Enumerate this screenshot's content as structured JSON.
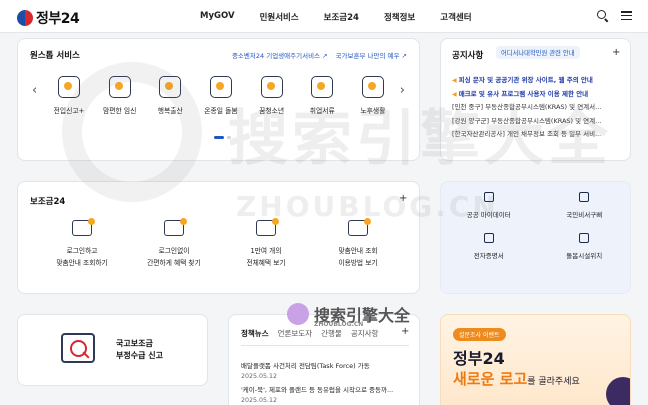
{
  "header": {
    "logo_text": "정부24",
    "nav": [
      "MyGOV",
      "민원서비스",
      "보조금24",
      "정책정보",
      "고객센터"
    ]
  },
  "online_services": {
    "title": "원스톱 서비스",
    "links": [
      "중소벤처24 기업생애주기서비스 ↗",
      "국가보훈부 나만의 예우 ↗"
    ],
    "items": [
      {
        "label": "전입신고+",
        "icon": "house-icon"
      },
      {
        "label": "맘편한 임신",
        "icon": "pregnancy-icon"
      },
      {
        "label": "행복출산",
        "icon": "baby-icon"
      },
      {
        "label": "온종일 돌봄",
        "icon": "ribbon-icon"
      },
      {
        "label": "꿈청소년",
        "icon": "book-icon"
      },
      {
        "label": "취업서류",
        "icon": "briefcase-icon"
      },
      {
        "label": "노후생활",
        "icon": "senior-icon"
      }
    ]
  },
  "notices": {
    "title": "공지사항",
    "badge": "어디서나대학민원 관련 안내",
    "items": [
      {
        "text": "피싱 문자 및 공공기관 위장 사이트, 웹 주의 안내",
        "highlight": true
      },
      {
        "text": "매크로 및 유사 프로그램 사용자 이용 제한 안내",
        "highlight": true
      },
      {
        "text": "[인천 중구] 부동산종합공부시스템(KRAS) 및 연계서...",
        "highlight": false
      },
      {
        "text": "[강원 양구군] 부동산종합공부시스템(KRAS) 및 연계...",
        "highlight": false
      },
      {
        "text": "[한국자산관리공사] 개인 채무정보 조회 등 일부 서비...",
        "highlight": false
      }
    ]
  },
  "bojo": {
    "title": "보조금24",
    "items": [
      {
        "label": "로그인하고\n맞춤안내 조회하기",
        "icon": "monitor-icon"
      },
      {
        "label": "로그인없이\n간편하게 혜택 찾기",
        "icon": "list-icon"
      },
      {
        "label": "1만여 개의\n전체혜택 보기",
        "icon": "lamp-icon"
      },
      {
        "label": "맞춤안내 조회\n이용방법 보기",
        "icon": "screen-icon"
      }
    ]
  },
  "quick_links": [
    {
      "label": "공공 마이데이터",
      "icon": "hand-data-icon"
    },
    {
      "label": "국민비서구삐",
      "icon": "chat-icon"
    },
    {
      "label": "전자증명서",
      "icon": "document-icon"
    },
    {
      "label": "돌봄시설위치",
      "icon": "location-pin-icon"
    }
  ],
  "report": {
    "text": "국고보조금\n부정수급 신고"
  },
  "news": {
    "tabs": [
      "정책뉴스",
      "언론보도자",
      "간행물",
      "공지사항"
    ],
    "items": [
      {
        "title": "배달플랫폼 사건처리 전담팀(Task Force) 가동",
        "date": "2025.05.12"
      },
      {
        "title": "'케이-북', 제포와 플랜드 등 동유럽을 시작으로 중동까...",
        "date": "2025.05.12"
      }
    ]
  },
  "banner": {
    "tag": "설문조사 이벤트",
    "title": "정부24",
    "sub_highlight": "새로운 로고",
    "sub_rest": "를 골라주세요"
  },
  "watermark": {
    "zh": "搜索引擎大全",
    "en": "ZHOUBLOG.CN",
    "small": "搜索引擎大全",
    "small_url": "ZHOUBLOG.CN"
  },
  "colors": {
    "accent": "#1f57c3",
    "brand_red": "#d6282d",
    "orange": "#ee8b1f",
    "icon_highlight": "#f5a623"
  }
}
